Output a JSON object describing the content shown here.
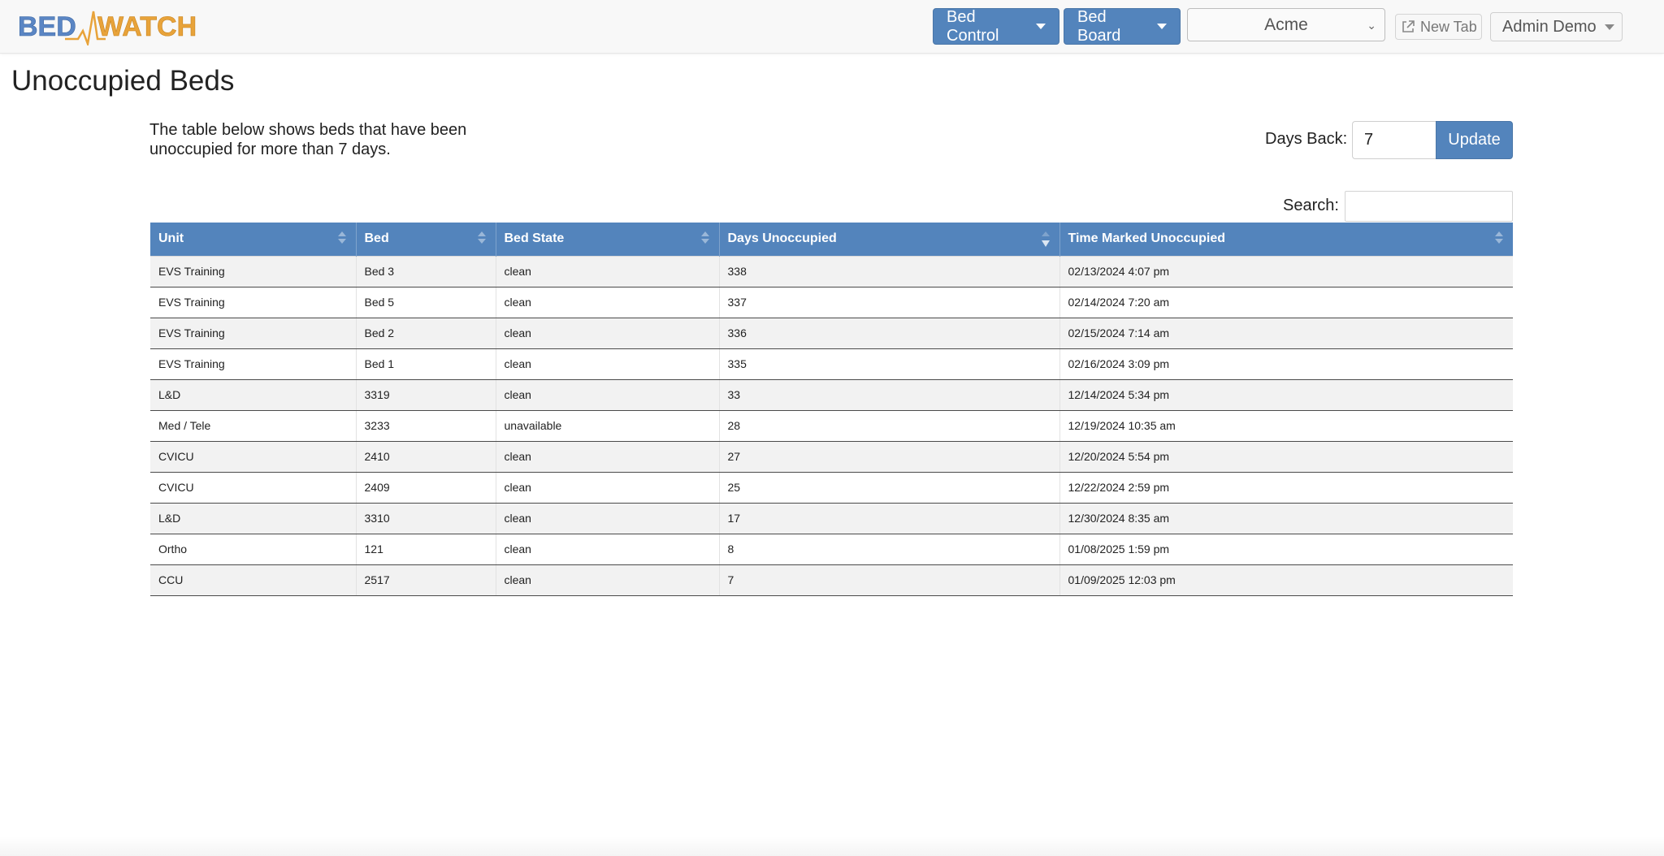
{
  "app": {
    "logo_text": "BEDWATCH",
    "colors": {
      "brand_blue": "#5384bc",
      "logo_blue": "#5b86c4",
      "logo_orange": "#e8a33a"
    }
  },
  "navbar": {
    "bed_control_label": "Bed Control",
    "bed_board_label": "Bed Board",
    "org_select_value": "Acme",
    "new_tab_label": "New Tab",
    "user_label": "Admin Demo"
  },
  "page": {
    "title": "Unoccupied Beds",
    "intro": "The table below shows beds that have been unoccupied for more than 7 days."
  },
  "filters": {
    "days_back_label": "Days Back:",
    "days_back_value": "7",
    "update_label": "Update",
    "search_label": "Search:"
  },
  "table": {
    "columns": [
      "Unit",
      "Bed",
      "Bed State",
      "Days Unoccupied",
      "Time Marked Unoccupied"
    ],
    "sorted_column": "Days Unoccupied",
    "sort_direction": "descending",
    "rows": [
      [
        "EVS Training",
        "Bed 3",
        "clean",
        "338",
        "02/13/2024 4:07 pm"
      ],
      [
        "EVS Training",
        "Bed 5",
        "clean",
        "337",
        "02/14/2024 7:20 am"
      ],
      [
        "EVS Training",
        "Bed 2",
        "clean",
        "336",
        "02/15/2024 7:14 am"
      ],
      [
        "EVS Training",
        "Bed 1",
        "clean",
        "335",
        "02/16/2024 3:09 pm"
      ],
      [
        "L&D",
        "3319",
        "clean",
        "33",
        "12/14/2024 5:34 pm"
      ],
      [
        "Med / Tele",
        "3233",
        "unavailable",
        "28",
        "12/19/2024 10:35 am"
      ],
      [
        "CVICU",
        "2410",
        "clean",
        "27",
        "12/20/2024 5:54 pm"
      ],
      [
        "CVICU",
        "2409",
        "clean",
        "25",
        "12/22/2024 2:59 pm"
      ],
      [
        "L&D",
        "3310",
        "clean",
        "17",
        "12/30/2024 8:35 am"
      ],
      [
        "Ortho",
        "121",
        "clean",
        "8",
        "01/08/2025 1:59 pm"
      ],
      [
        "CCU",
        "2517",
        "clean",
        "7",
        "01/09/2025 12:03 pm"
      ]
    ]
  }
}
